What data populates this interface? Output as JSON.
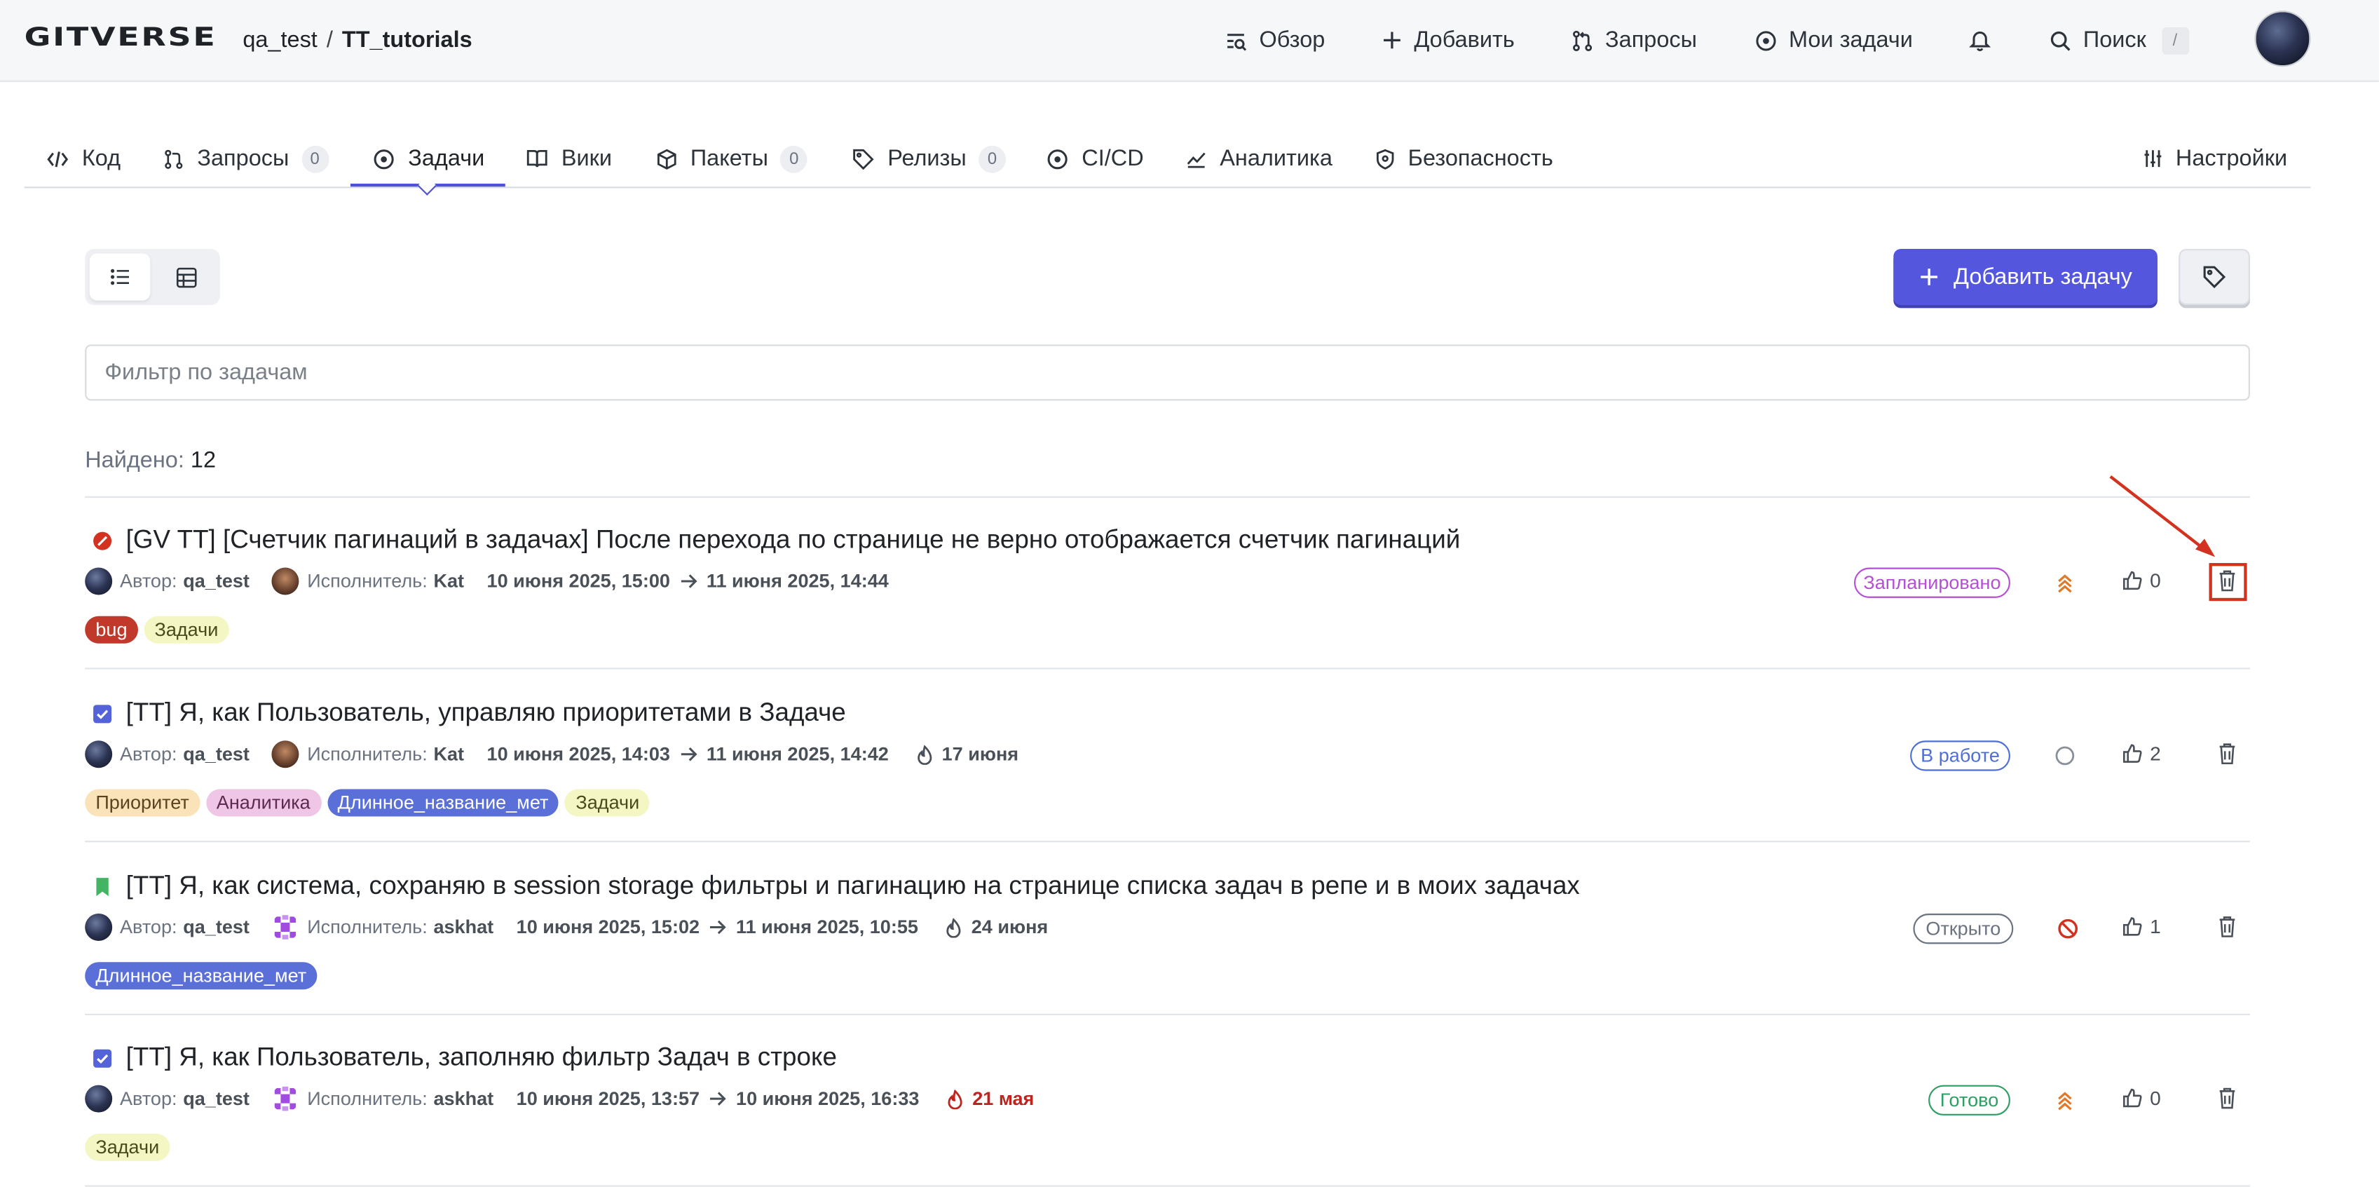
{
  "header": {
    "logo": "GITVERSE",
    "owner": "qa_test",
    "repo": "TT_tutorials",
    "nav": {
      "overview": "Обзор",
      "add": "Добавить",
      "requests": "Запросы",
      "my_tasks": "Мои задачи",
      "search": "Поиск",
      "search_key": "/"
    }
  },
  "tabs": {
    "code": "Код",
    "requests": "Запросы",
    "requests_count": "0",
    "issues": "Задачи",
    "wiki": "Вики",
    "packages": "Пакеты",
    "packages_count": "0",
    "releases": "Релизы",
    "releases_count": "0",
    "cicd": "CI/CD",
    "analytics": "Аналитика",
    "security": "Безопасность",
    "settings": "Настройки"
  },
  "toolbar": {
    "add_task": "Добавить задачу",
    "filter_placeholder": "Фильтр по задачам"
  },
  "found": {
    "label": "Найдено:",
    "count": "12"
  },
  "common": {
    "author_label": "Автор:",
    "assignee_label": "Исполнитель:"
  },
  "tasks": [
    {
      "title": "[GV TT] [Счетчик пагинаций в задачах] После перехода по странице не верно отображается счетчик пагинаций",
      "type_icon": "bug-icon",
      "author": "qa_test",
      "assignee": "Kat",
      "start": "10 июня 2025, 15:00",
      "end": "11 июня 2025, 14:44",
      "due": "",
      "labels": [
        {
          "text": "bug",
          "bg": "#c0392b",
          "fg": "#ffffff"
        },
        {
          "text": "Задачи",
          "bg": "#f4f7c4",
          "fg": "#4a4a1e"
        }
      ],
      "status": "Запланировано",
      "status_color": "#b44fd6",
      "priority_icon": "priority-high-icon",
      "likes": "0"
    },
    {
      "title": "[TT] Я, как Пользователь, управляю приоритетами в Задаче",
      "type_icon": "task-checkbox-icon",
      "author": "qa_test",
      "assignee": "Kat",
      "start": "10 июня 2025, 14:03",
      "end": "11 июня 2025, 14:42",
      "due": "17 июня",
      "labels": [
        {
          "text": "Приоритет",
          "bg": "#fbe3b9",
          "fg": "#5a4320"
        },
        {
          "text": "Аналитика",
          "bg": "#f0c6e6",
          "fg": "#5e2a52"
        },
        {
          "text": "Длинное_название_мет",
          "bg": "#5a6fd8",
          "fg": "#ffffff"
        },
        {
          "text": "Задачи",
          "bg": "#f4f7c4",
          "fg": "#4a4a1e"
        }
      ],
      "status": "В работе",
      "status_color": "#4f6fd6",
      "priority_icon": "priority-none-icon",
      "likes": "2"
    },
    {
      "title": "[TT] Я, как система, сохраняю в session storage фильтры и пагинацию на странице списка задач в репе и в моих задачах",
      "type_icon": "story-bookmark-icon",
      "author": "qa_test",
      "assignee": "askhat",
      "start": "10 июня 2025, 15:02",
      "end": "11 июня 2025, 10:55",
      "due": "24 июня",
      "labels": [
        {
          "text": "Длинное_название_мет",
          "bg": "#5a6fd8",
          "fg": "#ffffff"
        }
      ],
      "status": "Открыто",
      "status_color": "#6b7280",
      "priority_icon": "blocked-icon",
      "likes": "1"
    },
    {
      "title": "[TT] Я, как Пользователь, заполняю фильтр Задач в строке",
      "type_icon": "task-checkbox-icon",
      "author": "qa_test",
      "assignee": "askhat",
      "start": "10 июня 2025, 13:57",
      "end": "10 июня 2025, 16:33",
      "due": "21 мая",
      "labels": [
        {
          "text": "Задачи",
          "bg": "#f4f7c4",
          "fg": "#4a4a1e"
        }
      ],
      "status": "Готово",
      "status_color": "#2e9e63",
      "priority_icon": "priority-high-icon",
      "likes": "0"
    }
  ]
}
